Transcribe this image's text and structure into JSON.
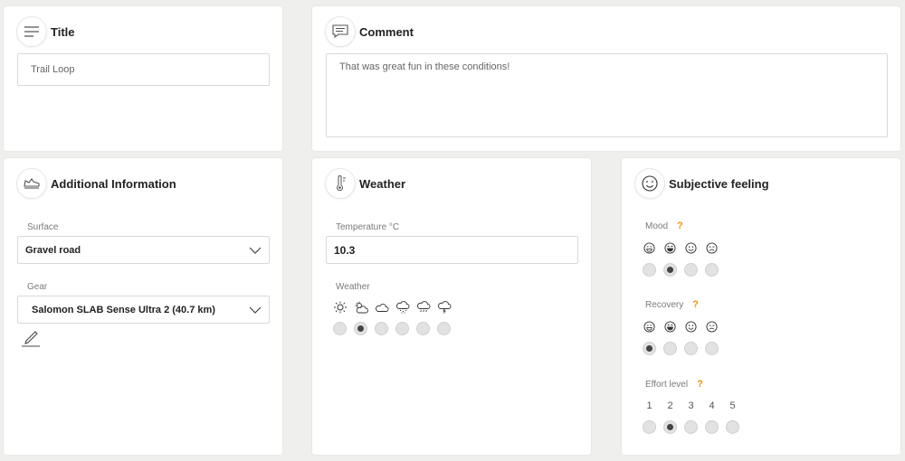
{
  "title_card": {
    "heading": "Title",
    "value": "Trail Loop"
  },
  "comment_card": {
    "heading": "Comment",
    "value": "That was great fun in these conditions!"
  },
  "additional_card": {
    "heading": "Additional Information",
    "surface_label": "Surface",
    "surface_value": "Gravel road",
    "gear_label": "Gear",
    "gear_value": "Salomon SLAB Sense Ultra 2 (40.7 km)"
  },
  "weather_card": {
    "heading": "Weather",
    "temperature_label": "Temperature °C",
    "temperature_value": "10.3",
    "weather_label": "Weather",
    "options": [
      "sun-icon",
      "partly-sunny-icon",
      "cloud-icon",
      "snow-cloud-icon",
      "rain-cloud-icon",
      "thunder-cloud-icon"
    ],
    "selected_index": 1
  },
  "feeling_card": {
    "heading": "Subjective feeling",
    "help_mark": "?",
    "mood": {
      "label": "Mood",
      "selected_index": 1
    },
    "recovery": {
      "label": "Recovery",
      "selected_index": 0
    },
    "effort": {
      "label": "Effort level",
      "levels": [
        "1",
        "2",
        "3",
        "4",
        "5"
      ],
      "selected_index": 1
    }
  },
  "colors": {
    "accent": "#e8941a",
    "selected_dot": "#444444"
  }
}
